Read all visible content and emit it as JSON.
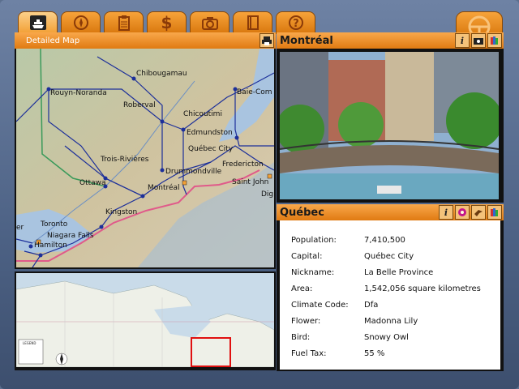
{
  "tabs": [
    {
      "icon": "ship-icon"
    },
    {
      "icon": "compass-icon"
    },
    {
      "icon": "clipboard-icon"
    },
    {
      "icon": "dollar-icon"
    },
    {
      "icon": "camera-icon"
    },
    {
      "icon": "notebook-icon"
    },
    {
      "icon": "help-icon"
    }
  ],
  "tab_labels": {
    "dollar": "$",
    "help": "?"
  },
  "map_panel": {
    "title": "Detailed Map"
  },
  "map_cities": [
    "Chibougamau",
    "Rouyn-Noranda",
    "Roberval",
    "Baie-Com",
    "Chicoutimi",
    "Edmundston",
    "Québec City",
    "Fredericton",
    "Trois-Rivières",
    "Drummondville",
    "Ottawa",
    "Montréal",
    "Saint John",
    "Dig",
    "Kingston",
    "Toronto",
    "Niagara Falls",
    "Hamilton",
    "er"
  ],
  "minimap": {
    "legend_title": "LEGEND"
  },
  "photo_panel": {
    "title": "Montréal",
    "info_icon": "i"
  },
  "info_panel": {
    "title": "Québec",
    "info_icon": "i",
    "rows": [
      {
        "label": "Population:",
        "value": "7,410,500"
      },
      {
        "label": "Capital:",
        "value": "Québec City"
      },
      {
        "label": "Nickname:",
        "value": "La Belle Province"
      },
      {
        "label": "Area:",
        "value": "1,542,056 square kilometres"
      },
      {
        "label": "Climate Code:",
        "value": "Dfa"
      },
      {
        "label": "Flower:",
        "value": "Madonna Lily"
      },
      {
        "label": "Bird:",
        "value": "Snowy Owl"
      },
      {
        "label": "Fuel Tax:",
        "value": "55 %"
      }
    ]
  },
  "colors": {
    "accent": "#f29a2e",
    "frame": "#5b6f8e",
    "route": "#1c2f9a",
    "border": "#e05a8a"
  }
}
